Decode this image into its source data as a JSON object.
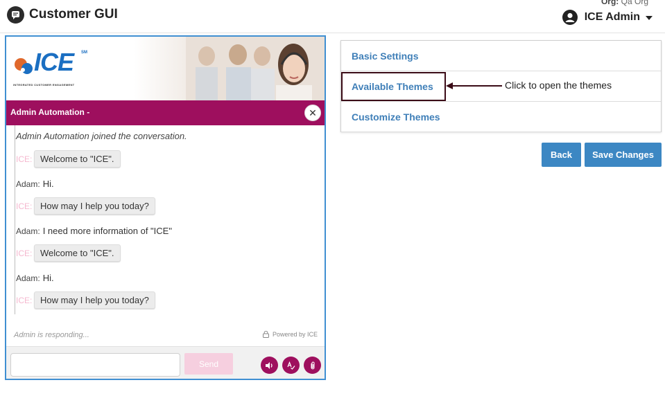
{
  "header": {
    "app_title": "Customer GUI",
    "org_label": "Org:",
    "org_value": "Qa Org",
    "user_name": "ICE Admin"
  },
  "chat": {
    "brand": {
      "name": "ICE",
      "mark": "SM",
      "tagline": "INTEGRATED CUSTOMER ENGAGEMENT"
    },
    "header_title": "Admin Automation -",
    "close_symbol": "✕",
    "system_message": "Admin Automation joined the conversation.",
    "messages": [
      {
        "sender": "ICE:",
        "text": "Welcome to \"ICE\"."
      },
      {
        "sender": "Adam:",
        "text": "Hi."
      },
      {
        "sender": "ICE:",
        "text": "How may I help you today?"
      },
      {
        "sender": "Adam:",
        "text": "I need more information of \"ICE\""
      },
      {
        "sender": "ICE:",
        "text": "Welcome to \"ICE\"."
      },
      {
        "sender": "Adam:",
        "text": "Hi."
      },
      {
        "sender": "ICE:",
        "text": "How may I help you today?"
      }
    ],
    "typing_status": "Admin is responding...",
    "powered_by": "Powered by ICE",
    "input_value": "",
    "input_placeholder": "",
    "send_label": "Send",
    "icons": [
      "speaker-icon",
      "spell-check-icon",
      "attachment-icon"
    ]
  },
  "settings": {
    "items": [
      {
        "label": "Basic Settings"
      },
      {
        "label": "Available Themes"
      },
      {
        "label": "Customize Themes"
      }
    ],
    "callout": "Click to open the themes",
    "back_label": "Back",
    "save_label": "Save Changes"
  },
  "colors": {
    "accent": "#9e0f5e",
    "link": "#3f7fb8",
    "button": "#3c87c3",
    "send_disabled": "#f6cfdf"
  }
}
